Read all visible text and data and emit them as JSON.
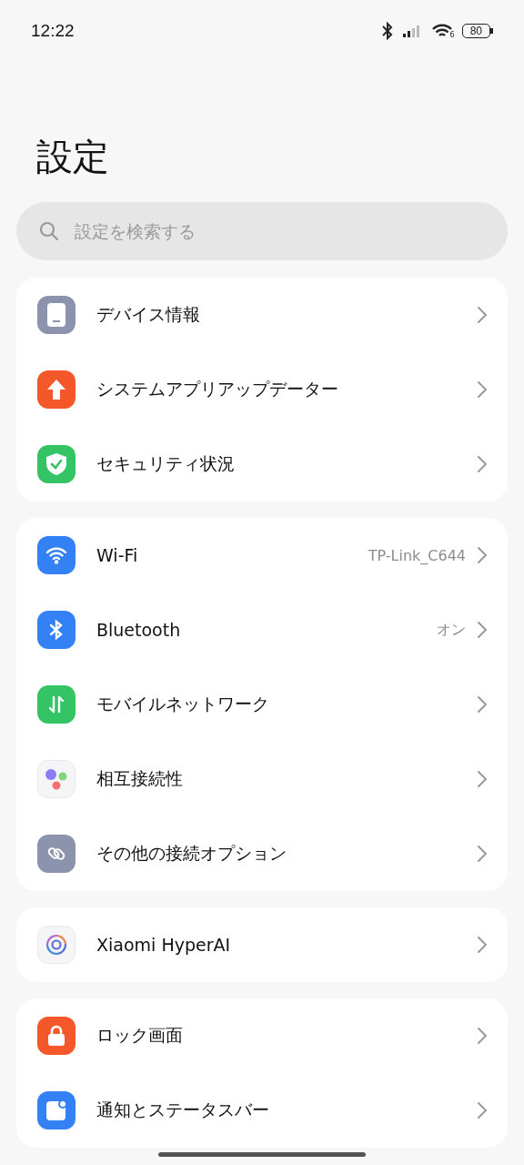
{
  "status_bar": {
    "time": "12:22",
    "wifi_badge": "6",
    "battery": "80"
  },
  "title": "設定",
  "search": {
    "placeholder": "設定を検索する"
  },
  "groups": [
    {
      "items": [
        {
          "label": "デバイス情報"
        },
        {
          "label": "システムアプリアップデーター"
        },
        {
          "label": "セキュリティ状況"
        }
      ]
    },
    {
      "items": [
        {
          "label": "Wi-Fi",
          "value": "TP-Link_C644"
        },
        {
          "label": "Bluetooth",
          "value": "オン"
        },
        {
          "label": "モバイルネットワーク"
        },
        {
          "label": "相互接続性"
        },
        {
          "label": "その他の接続オプション"
        }
      ]
    },
    {
      "items": [
        {
          "label": "Xiaomi HyperAI"
        }
      ]
    },
    {
      "items": [
        {
          "label": "ロック画面"
        },
        {
          "label": "通知とステータスバー"
        }
      ]
    }
  ]
}
